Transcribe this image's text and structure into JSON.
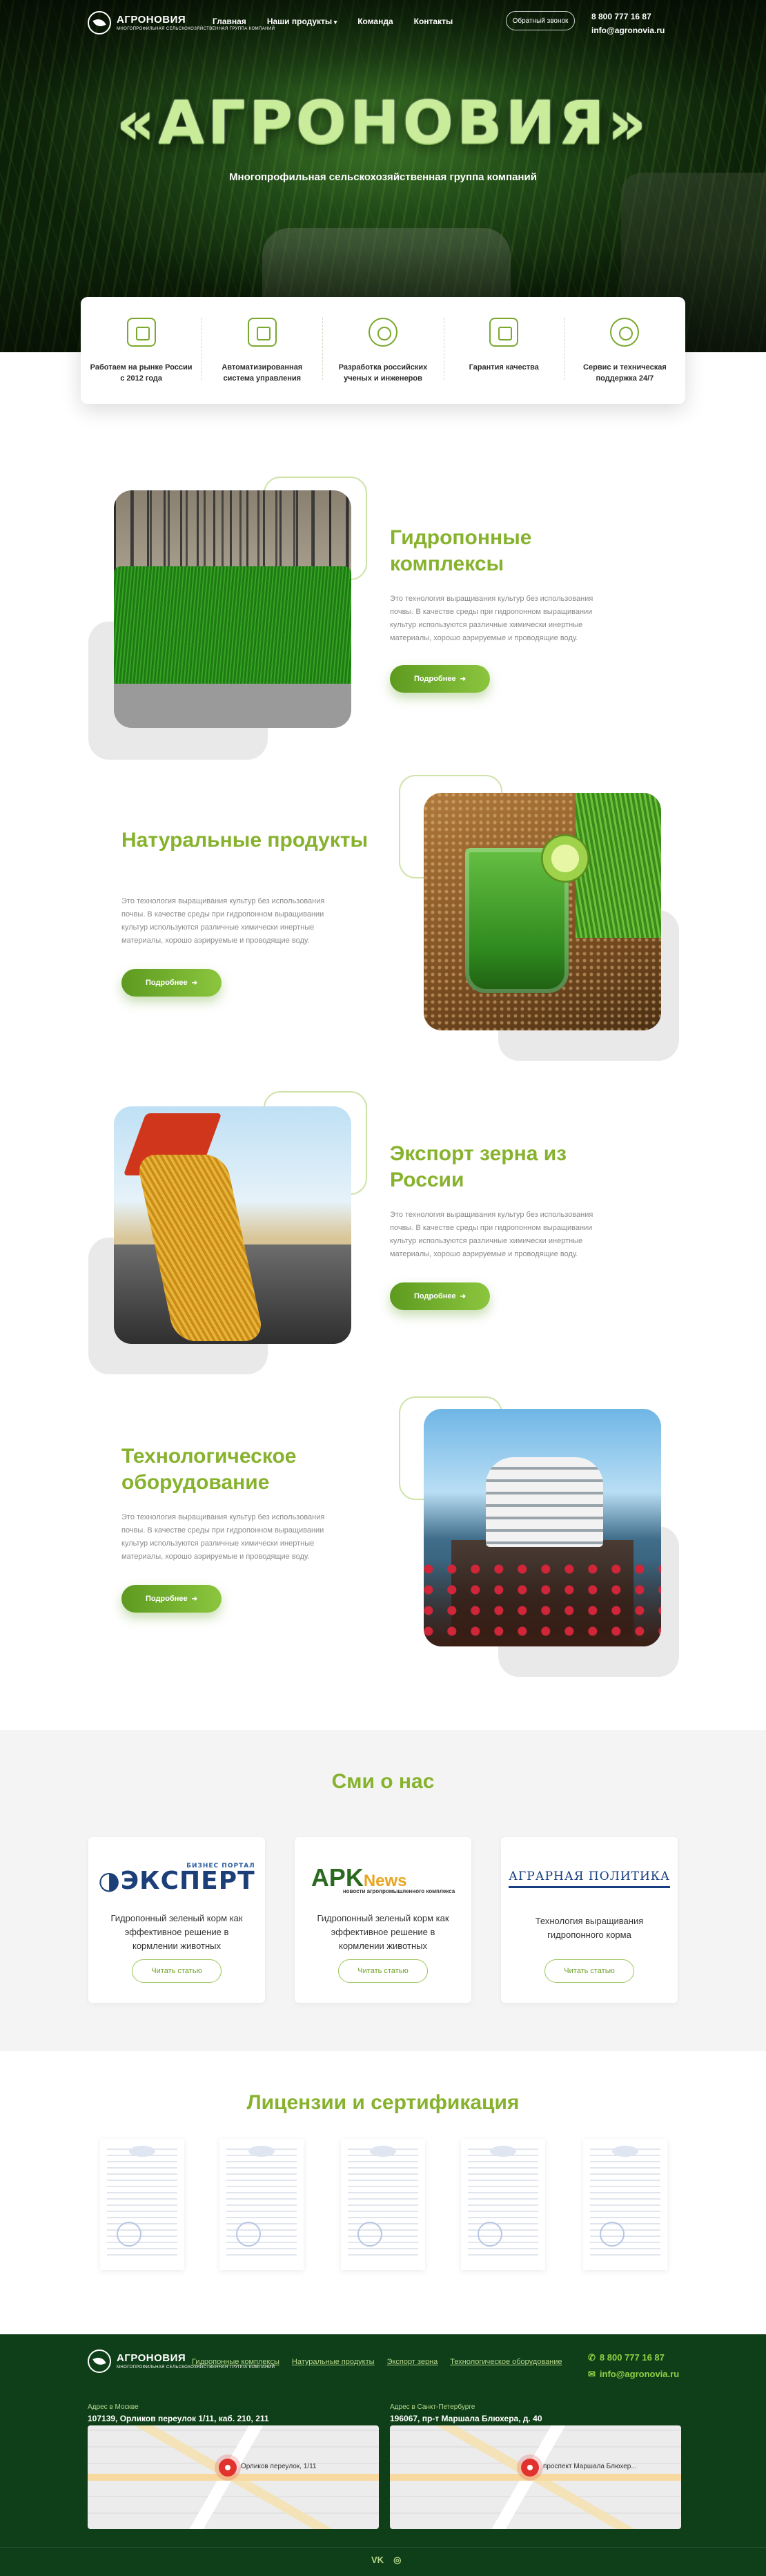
{
  "brand": {
    "name": "АГРОНОВИЯ",
    "tagline": "МНОГОПРОФИЛЬНАЯ СЕЛЬСКОХОЗЯЙСТВЕННАЯ ГРУППА КОМПАНИЙ"
  },
  "nav": {
    "items": [
      "Главная",
      "Наши продукты",
      "Команда",
      "Контакты"
    ],
    "callback": "Обратный звонок",
    "phone": "8 800 777 16 87",
    "email": "info@agronovia.ru"
  },
  "hero": {
    "title": "«АГРОНОВИЯ»",
    "subtitle": "Многопрофильная сельскохозяйственная группа компаний"
  },
  "features": [
    {
      "icon": "briefcase-icon",
      "label": "Работаем на рынке России с 2012 года"
    },
    {
      "icon": "chip-icon",
      "label": "Автоматизированная система управления"
    },
    {
      "icon": "gear-badge-icon",
      "label": "Разработка российских ученых и инженеров"
    },
    {
      "icon": "quality-shield-icon",
      "label": "Гарантия качества"
    },
    {
      "icon": "support-24-icon",
      "label": "Сервис и техническая поддержка 24/7"
    }
  ],
  "products": [
    {
      "title": "Гидропонные комплексы",
      "text": "Это технология выращивания культур без использования почвы. В качестве среды при гидропонном выращивании культур используются различные химически инертные материалы, хорошо аэрируемые и проводящие воду.",
      "button": "Подробнее"
    },
    {
      "title": "Натуральные продукты",
      "text": "Это технология выращивания культур без использования почвы. В качестве среды при гидропонном выращивании культур используются различные химически инертные материалы, хорошо аэрируемые и проводящие воду.",
      "button": "Подробнее"
    },
    {
      "title": "Экспорт зерна из России",
      "text": "Это технология выращивания культур без использования почвы. В качестве среды при гидропонном выращивании культур используются различные химически инертные материалы, хорошо аэрируемые и проводящие воду.",
      "button": "Подробнее"
    },
    {
      "title": "Технологическое оборудование",
      "text": "Это технология выращивания культур без использования почвы. В качестве среды при гидропонном выращивании культур используются различные химически инертные материалы, хорошо аэрируемые и проводящие воду.",
      "button": "Подробнее"
    }
  ],
  "smi": {
    "title": "Сми о нас",
    "cards": [
      {
        "logo_top": "БИЗНЕС ПОРТАЛ",
        "logo_main": "ЭКСПЕРТ",
        "text": "Гидропонный зеленый корм как эффективное решение в кормлении животных",
        "button": "Читать статью"
      },
      {
        "logo_main": "APK",
        "logo_accent": "News",
        "logo_sub": "новости агропромышленного комплекса",
        "text": "Гидропонный зеленый корм как эффективное решение в кормлении животных",
        "button": "Читать статью"
      },
      {
        "logo_main": "АГРАРНАЯ ПОЛИТИКА",
        "text": "Технология выращивания гидропонного корма",
        "button": "Читать статью"
      }
    ]
  },
  "licenses": {
    "title": "Лицензии и сертификация"
  },
  "footer": {
    "links": [
      "Гидропонные комплексы",
      "Натуральные продукты",
      "Экспорт зерна",
      "Технологическое оборудование"
    ],
    "phone": "8 800 777 16 87",
    "email": "info@agronovia.ru",
    "offices": [
      {
        "label": "Адрес в Москве",
        "address": "107139, Орликов переулок 1/11, каб. 210, 211",
        "map_label": "Орликов переулок, 1/11"
      },
      {
        "label": "Адрес в Санкт-Петербурге",
        "address": "196067, пр-т Маршала Блюхера, д. 40",
        "map_label": "проспект Маршала Блюхер..."
      }
    ],
    "social": [
      "VK",
      "◎"
    ]
  },
  "colors": {
    "accent": "#86b22d",
    "button": "#6fae2a",
    "footer_bg": "#0f3f18",
    "hero_dark": "#0d2109"
  }
}
